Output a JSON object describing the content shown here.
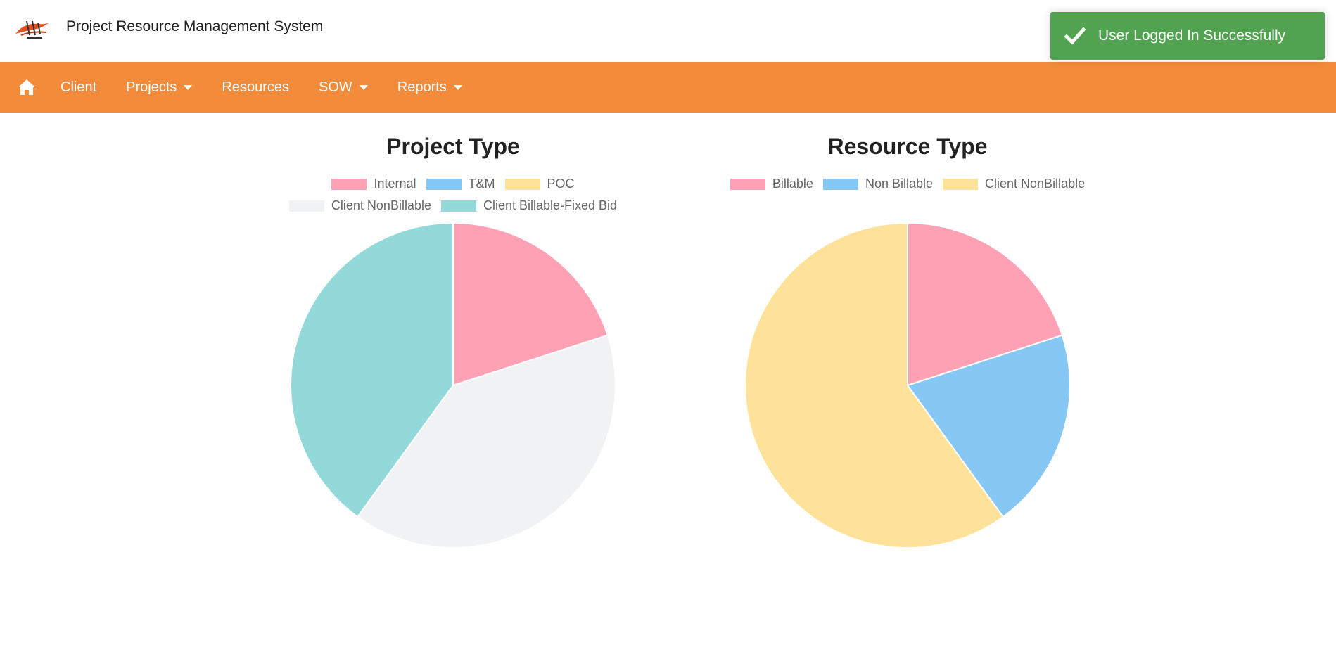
{
  "header": {
    "app_title": "Project Resource Management System"
  },
  "navbar": {
    "background": "#f38c3a",
    "items": [
      {
        "label": "Client",
        "dropdown": false
      },
      {
        "label": "Projects",
        "dropdown": true
      },
      {
        "label": "Resources",
        "dropdown": false
      },
      {
        "label": "SOW",
        "dropdown": true
      },
      {
        "label": "Reports",
        "dropdown": true
      }
    ]
  },
  "toast": {
    "message": "User Logged In Successfully",
    "color": "#51a351",
    "icon": "checkmark-icon"
  },
  "chart_data": [
    {
      "type": "pie",
      "title": "Project Type",
      "legend_position": "top",
      "categories": [
        "Internal",
        "T&M",
        "POC",
        "Client NonBillable",
        "Client Billable-Fixed Bid"
      ],
      "values": [
        1,
        0,
        0,
        2,
        2
      ],
      "colors": [
        "#ffa1b5",
        "#86c7f3",
        "#ffe29a",
        "#f1f2f4",
        "#93d9d9"
      ]
    },
    {
      "type": "pie",
      "title": "Resource Type",
      "legend_position": "top",
      "categories": [
        "Billable",
        "Non Billable",
        "Client NonBillable"
      ],
      "values": [
        1,
        1,
        3
      ],
      "colors": [
        "#ffa1b5",
        "#86c7f3",
        "#ffe29a"
      ]
    }
  ]
}
